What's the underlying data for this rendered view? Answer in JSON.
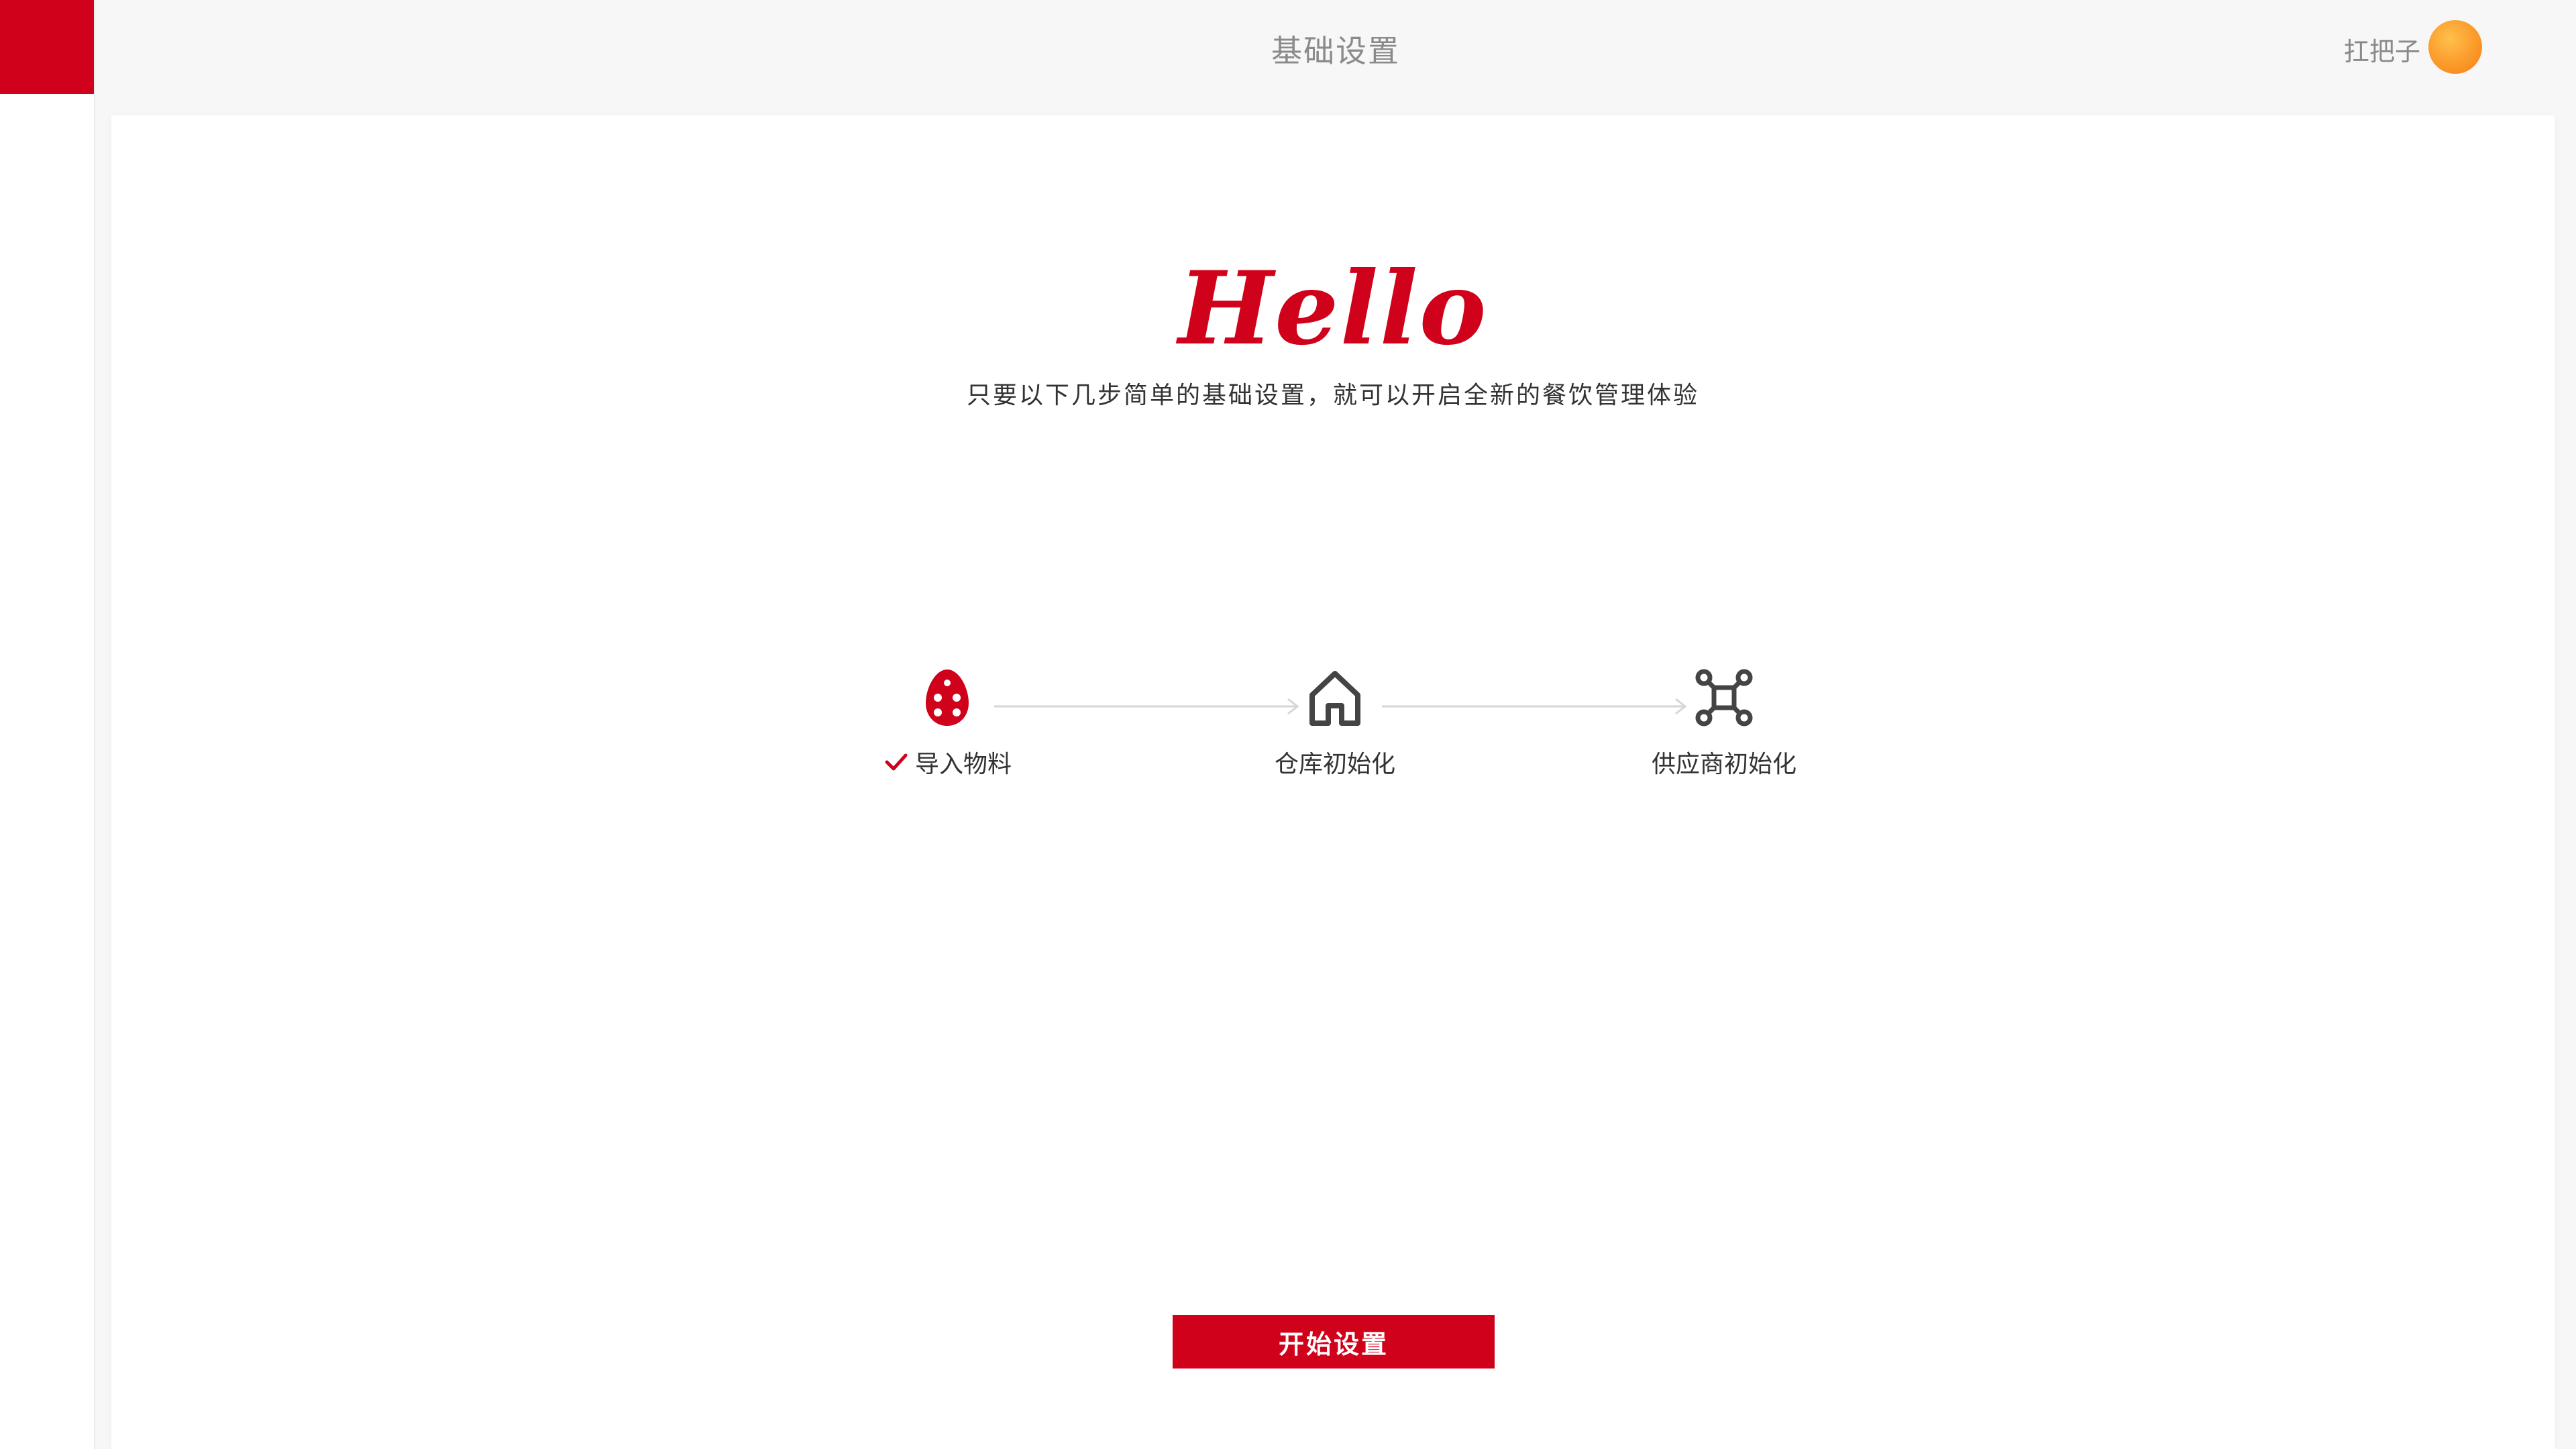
{
  "header": {
    "title": "基础设置",
    "user_name": "扛把子"
  },
  "welcome": {
    "greeting": "Hello",
    "subtitle": "只要以下几步简单的基础设置，就可以开启全新的餐饮管理体验"
  },
  "steps": [
    {
      "label": "导入物料",
      "icon": "egg-icon",
      "completed": true
    },
    {
      "label": "仓库初始化",
      "icon": "house-icon",
      "completed": false
    },
    {
      "label": "供应商初始化",
      "icon": "network-icon",
      "completed": false
    }
  ],
  "actions": {
    "start_label": "开始设置"
  },
  "colors": {
    "accent": "#d0021b",
    "step_inactive": "#444444",
    "avatar": "#fb9a2a"
  }
}
